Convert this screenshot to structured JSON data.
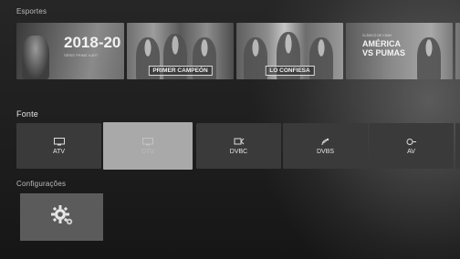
{
  "sections": {
    "sports_label": "Esportes",
    "source_label": "Fonte",
    "settings_label": "Configurações"
  },
  "banners": [
    {
      "id": "b1",
      "headline": "2018-20",
      "subline": "SÉRIE PRIME KART"
    },
    {
      "id": "b2",
      "caption": "PRIMER CAMPEÓN"
    },
    {
      "id": "b3",
      "caption": "LO CONFIESA"
    },
    {
      "id": "b4",
      "kicker": "CLÁSICO DE CDMX",
      "title_line1": "AMÉRICA",
      "title_line2": "VS PUMAS"
    },
    {
      "id": "b5"
    }
  ],
  "sources": [
    {
      "label": "ATV",
      "icon": "tv-icon"
    },
    {
      "label": "DTV",
      "icon": "tv-icon",
      "selected": true
    },
    {
      "label": "DVBC",
      "icon": "cable-icon"
    },
    {
      "label": "DVBS",
      "icon": "satellite-icon"
    },
    {
      "label": "AV",
      "icon": "av-input-icon"
    }
  ],
  "settings": {
    "icon": "gear-icon"
  },
  "colors": {
    "background": "#1b1b1b",
    "tile": "#3a3a3a",
    "tile_selected": "#a9a9a9",
    "settings_tile": "#5b5b5b"
  }
}
